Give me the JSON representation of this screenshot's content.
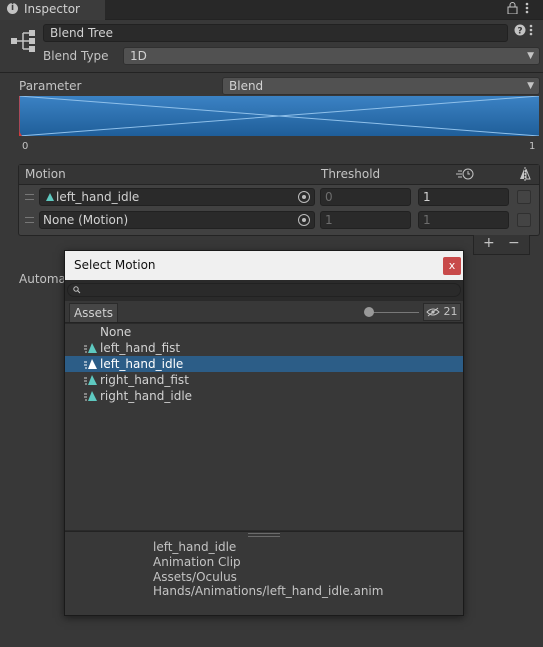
{
  "tab": {
    "title": "Inspector"
  },
  "header": {
    "name_value": "Blend Tree",
    "blend_type_label": "Blend Type",
    "blend_type_value": "1D"
  },
  "parameter": {
    "label": "Parameter",
    "value": "Blend",
    "range_min": "0",
    "range_max": "1"
  },
  "motion_list": {
    "col_motion": "Motion",
    "col_threshold": "Threshold",
    "rows": [
      {
        "motion": "left_hand_idle",
        "threshold_left": "0",
        "threshold_right": "1"
      },
      {
        "motion": "None (Motion)",
        "threshold_left": "1",
        "threshold_right": "1"
      }
    ],
    "add_label": "+",
    "remove_label": "−"
  },
  "automate_label": "Automat",
  "dialog": {
    "title": "Select Motion",
    "close_label": "x",
    "search_value": "",
    "tab_assets": "Assets",
    "visible_count": "21",
    "items": [
      {
        "label": "None",
        "has_icon": false,
        "selected": false
      },
      {
        "label": "left_hand_fist",
        "has_icon": true,
        "selected": false
      },
      {
        "label": "left_hand_idle",
        "has_icon": true,
        "selected": true
      },
      {
        "label": "right_hand_fist",
        "has_icon": true,
        "selected": false
      },
      {
        "label": "right_hand_idle",
        "has_icon": true,
        "selected": false
      }
    ],
    "preview": {
      "name": "left_hand_idle",
      "type": "Animation Clip",
      "path": "Assets/Oculus Hands/Animations/left_hand_idle.anim"
    },
    "selection_color": "#2c5d87",
    "close_color": "#c84a4a"
  },
  "colors": {
    "accent_blue": "#2a6fb0",
    "graph_red": "#d23c3c",
    "panel": "#383838"
  }
}
